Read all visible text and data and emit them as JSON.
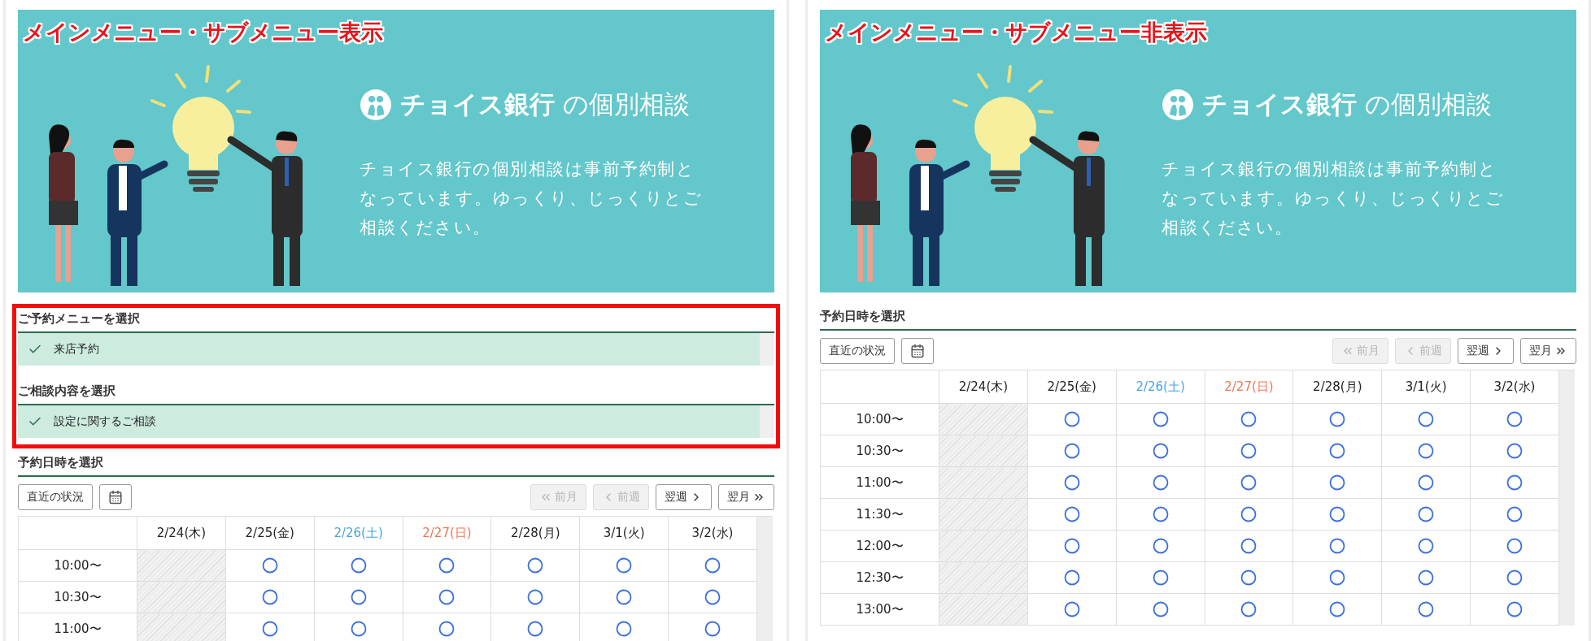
{
  "panels": [
    {
      "label": "メインメニュー・サブメニュー表示",
      "banner": {
        "brand": "チョイス銀行",
        "title": "の個別相談",
        "description": "チョイス銀行の個別相談は事前予約制となっています。ゆっくり、じっくりとご相談ください。"
      },
      "menus": [
        {
          "heading": "ご予約メニューを選択",
          "items": [
            {
              "label": "来店予約",
              "selected": true
            }
          ]
        },
        {
          "heading": "ご相談内容を選択",
          "items": [
            {
              "label": "設定に関するご相談",
              "selected": true
            }
          ]
        }
      ],
      "date_section": {
        "heading": "予約日時を選択",
        "recent_button": "直近の状況",
        "nav_buttons": [
          {
            "label": "前月",
            "kind": "prev-month",
            "disabled": true
          },
          {
            "label": "前週",
            "kind": "prev-week",
            "disabled": true
          },
          {
            "label": "翌週",
            "kind": "next-week",
            "disabled": false
          },
          {
            "label": "翌月",
            "kind": "next-month",
            "disabled": false
          }
        ],
        "days": [
          {
            "label": "2/24(木)",
            "color": "#222222"
          },
          {
            "label": "2/25(金)",
            "color": "#222222"
          },
          {
            "label": "2/26(土)",
            "color": "#4aa3df"
          },
          {
            "label": "2/27(日)",
            "color": "#ee7752"
          },
          {
            "label": "2/28(月)",
            "color": "#222222"
          },
          {
            "label": "3/1(火)",
            "color": "#222222"
          },
          {
            "label": "3/2(水)",
            "color": "#222222"
          }
        ],
        "rows": [
          {
            "time": "10:00〜",
            "slots": [
              {
                "available": false
              },
              {
                "available": true
              },
              {
                "available": true
              },
              {
                "available": true
              },
              {
                "available": true
              },
              {
                "available": true
              },
              {
                "available": true
              }
            ]
          },
          {
            "time": "10:30〜",
            "slots": [
              {
                "available": false
              },
              {
                "available": true
              },
              {
                "available": true
              },
              {
                "available": true
              },
              {
                "available": true
              },
              {
                "available": true
              },
              {
                "available": true
              }
            ]
          },
          {
            "time": "11:00〜",
            "slots": [
              {
                "available": false
              },
              {
                "available": true
              },
              {
                "available": true
              },
              {
                "available": true
              },
              {
                "available": true
              },
              {
                "available": true
              },
              {
                "available": true
              }
            ]
          }
        ]
      }
    },
    {
      "label": "メインメニュー・サブメニュー非表示",
      "banner": {
        "brand": "チョイス銀行",
        "title": "の個別相談",
        "description": "チョイス銀行の個別相談は事前予約制となっています。ゆっくり、じっくりとご相談ください。"
      },
      "date_section": {
        "heading": "予約日時を選択",
        "recent_button": "直近の状況",
        "nav_buttons": [
          {
            "label": "前月",
            "kind": "prev-month",
            "disabled": true
          },
          {
            "label": "前週",
            "kind": "prev-week",
            "disabled": true
          },
          {
            "label": "翌週",
            "kind": "next-week",
            "disabled": false
          },
          {
            "label": "翌月",
            "kind": "next-month",
            "disabled": false
          }
        ],
        "days": [
          {
            "label": "2/24(木)",
            "color": "#222222"
          },
          {
            "label": "2/25(金)",
            "color": "#222222"
          },
          {
            "label": "2/26(土)",
            "color": "#4aa3df"
          },
          {
            "label": "2/27(日)",
            "color": "#ee7752"
          },
          {
            "label": "2/28(月)",
            "color": "#222222"
          },
          {
            "label": "3/1(火)",
            "color": "#222222"
          },
          {
            "label": "3/2(水)",
            "color": "#222222"
          }
        ],
        "rows": [
          {
            "time": "10:00〜",
            "slots": [
              {
                "available": false
              },
              {
                "available": true
              },
              {
                "available": true
              },
              {
                "available": true
              },
              {
                "available": true
              },
              {
                "available": true
              },
              {
                "available": true
              }
            ]
          },
          {
            "time": "10:30〜",
            "slots": [
              {
                "available": false
              },
              {
                "available": true
              },
              {
                "available": true
              },
              {
                "available": true
              },
              {
                "available": true
              },
              {
                "available": true
              },
              {
                "available": true
              }
            ]
          },
          {
            "time": "11:00〜",
            "slots": [
              {
                "available": false
              },
              {
                "available": true
              },
              {
                "available": true
              },
              {
                "available": true
              },
              {
                "available": true
              },
              {
                "available": true
              },
              {
                "available": true
              }
            ]
          },
          {
            "time": "11:30〜",
            "slots": [
              {
                "available": false
              },
              {
                "available": true
              },
              {
                "available": true
              },
              {
                "available": true
              },
              {
                "available": true
              },
              {
                "available": true
              },
              {
                "available": true
              }
            ]
          },
          {
            "time": "12:00〜",
            "slots": [
              {
                "available": false
              },
              {
                "available": true
              },
              {
                "available": true
              },
              {
                "available": true
              },
              {
                "available": true
              },
              {
                "available": true
              },
              {
                "available": true
              }
            ]
          },
          {
            "time": "12:30〜",
            "slots": [
              {
                "available": false
              },
              {
                "available": true
              },
              {
                "available": true
              },
              {
                "available": true
              },
              {
                "available": true
              },
              {
                "available": true
              },
              {
                "available": true
              }
            ]
          },
          {
            "time": "13:00〜",
            "slots": [
              {
                "available": false
              },
              {
                "available": true
              },
              {
                "available": true
              },
              {
                "available": true
              },
              {
                "available": true
              },
              {
                "available": true
              },
              {
                "available": true
              }
            ]
          }
        ]
      }
    }
  ]
}
